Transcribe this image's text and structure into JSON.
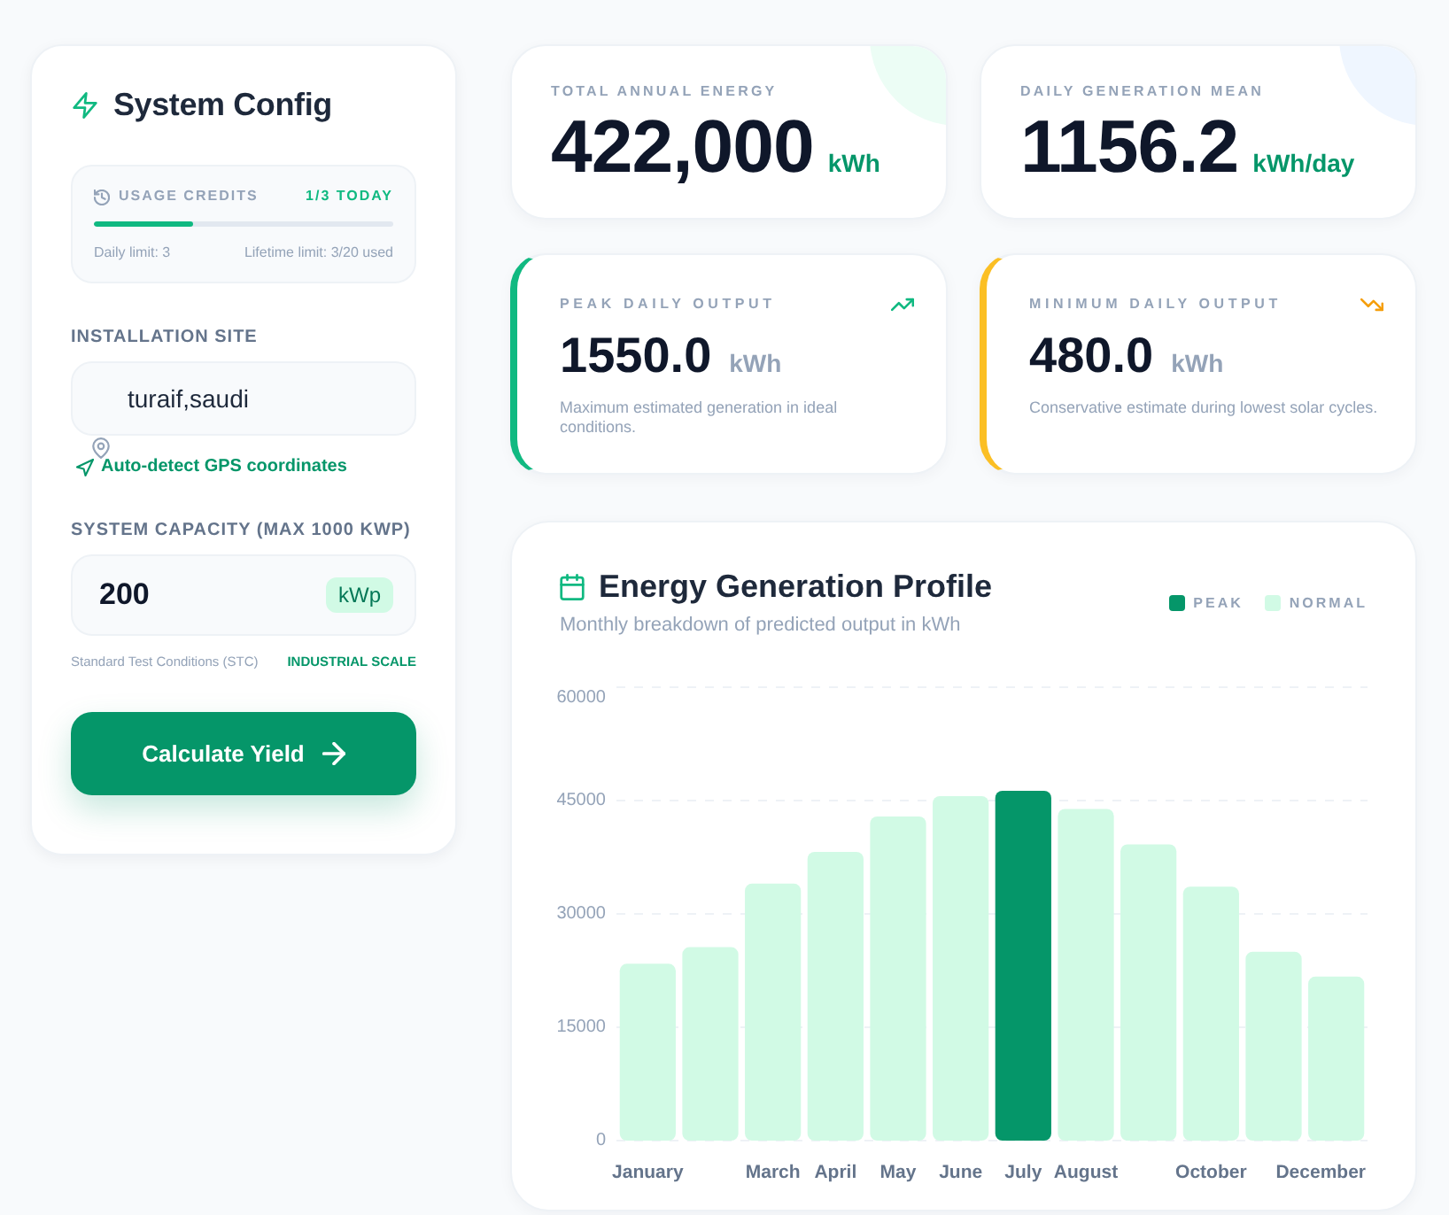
{
  "sidebar": {
    "title": "System Config",
    "usage": {
      "label": "USAGE CREDITS",
      "count": "1/3 TODAY",
      "level": 0.333,
      "daily": "Daily limit: 3",
      "lifetime": "Lifetime limit: 3/20 used"
    },
    "site": {
      "label": "INSTALLATION SITE",
      "value": "turaif,saudi",
      "link": "Auto-detect GPS coordinates"
    },
    "capacity": {
      "label": "SYSTEM CAPACITY (MAX 1000 KWP)",
      "value": "200",
      "unit": "kWp",
      "note": "Standard Test Conditions (STC)",
      "scale": "INDUSTRIAL SCALE"
    },
    "button": "Calculate Yield"
  },
  "stats": [
    {
      "label": "TOTAL ANNUAL ENERGY",
      "value": "422,000",
      "unit": "kWh",
      "color": "#ecfdf5"
    },
    {
      "label": "DAILY GENERATION MEAN",
      "value": "1156.2",
      "unit": "kWh/day",
      "color": "#eff6ff"
    }
  ],
  "extremes": [
    {
      "kind": "peak",
      "label": "PEAK DAILY OUTPUT",
      "value": "1550.0",
      "unit": "kWh",
      "description": "Maximum estimated generation in ideal conditions."
    },
    {
      "kind": "minimum",
      "label": "MINIMUM DAILY OUTPUT",
      "value": "480.0",
      "unit": "kWh",
      "description": "Conservative estimate during lowest solar cycles."
    }
  ],
  "chart": {
    "title": "Energy Generation Profile",
    "subtitle": "Monthly breakdown of predicted output in kWh",
    "chart_data": {
      "type": "bar",
      "categories": [
        "January",
        null,
        "March",
        "April",
        "May",
        "June",
        "July",
        "August",
        null,
        "October",
        null,
        "December"
      ],
      "series": [
        {
          "name": "PEAK",
          "color": "#059669",
          "values": [
            null,
            null,
            null,
            null,
            null,
            null,
            46300,
            null,
            null,
            null,
            null,
            null
          ]
        },
        {
          "name": "NORMAL",
          "color": "#d1fae5",
          "values": [
            23400,
            25600,
            34000,
            38200,
            42900,
            45600,
            null,
            43900,
            39200,
            33600,
            25000,
            21700
          ]
        }
      ],
      "stacked": true,
      "grid": true,
      "ylim": [
        0,
        60000
      ],
      "yticks": [
        0,
        15000,
        30000,
        45000,
        60000
      ]
    }
  }
}
